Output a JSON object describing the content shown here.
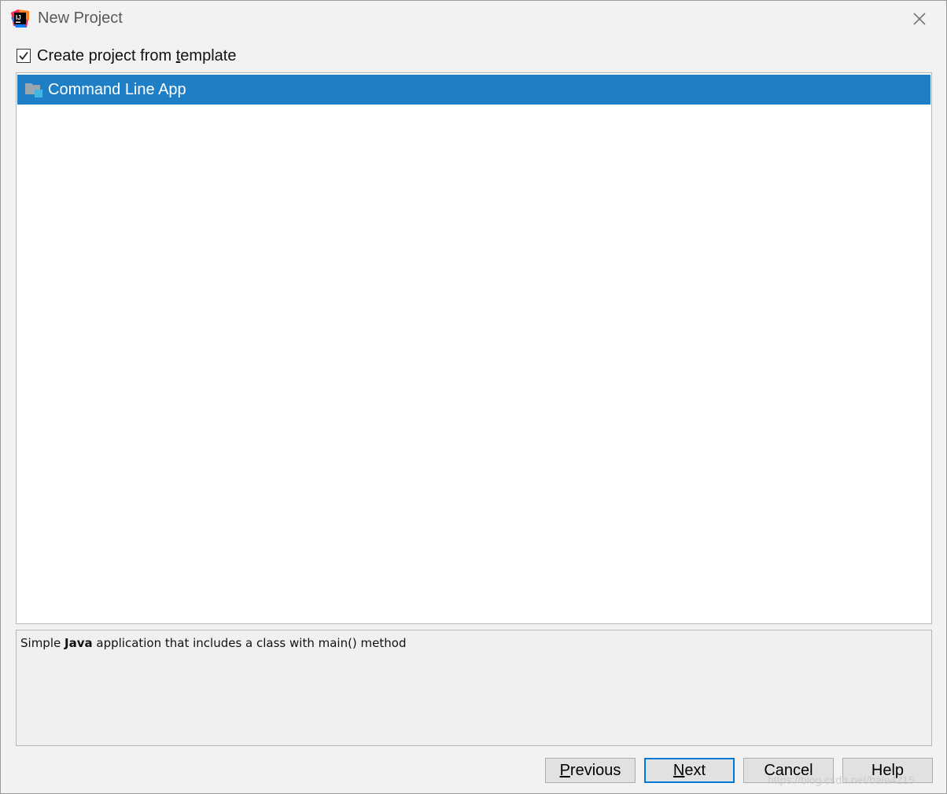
{
  "window": {
    "title": "New Project"
  },
  "template_checkbox": {
    "label_before": "Create project from ",
    "label_mnemonic": "t",
    "label_after": "emplate",
    "checked": true
  },
  "templates": [
    {
      "label": "Command Line App",
      "selected": true
    }
  ],
  "description": {
    "prefix": "Simple ",
    "bold": "Java",
    "suffix": " application that includes a class with main() method"
  },
  "buttons": {
    "previous": {
      "mnemonic": "P",
      "rest": "revious"
    },
    "next": {
      "mnemonic": "N",
      "rest": "ext"
    },
    "cancel": "Cancel",
    "help": "Help"
  },
  "colors": {
    "selection": "#1e7fc6",
    "primary_border": "#0078d7",
    "background": "#f2f2f2"
  },
  "watermark": "https://blog.csdn.net/bala4215"
}
